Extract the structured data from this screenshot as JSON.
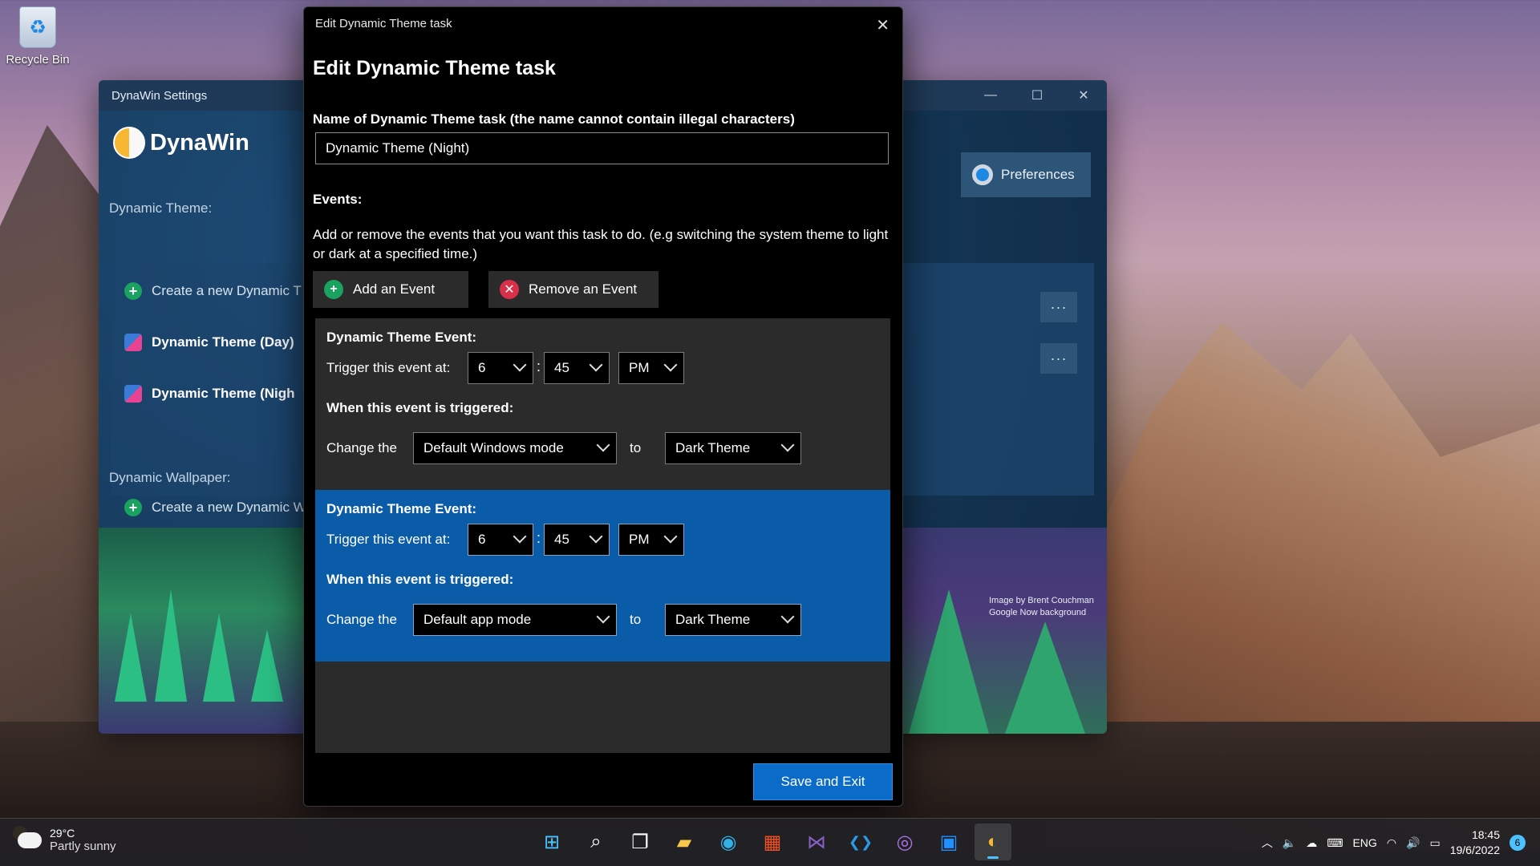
{
  "desktop": {
    "recycle_bin_label": "Recycle Bin"
  },
  "main_window": {
    "title": "DynaWin Settings",
    "app_name": "DynaWin",
    "controls": {
      "minimize": "—",
      "maximize": "☐",
      "close": "✕"
    },
    "dynamic_theme_label": "Dynamic Theme:",
    "dynamic_wallpaper_label": "Dynamic Wallpaper:",
    "preferences_label": "Preferences",
    "theme_items": [
      {
        "label": "Create a new Dynamic T",
        "type": "create"
      },
      {
        "label": "Dynamic Theme (Day)",
        "type": "theme"
      },
      {
        "label": "Dynamic Theme (Nigh",
        "type": "theme"
      }
    ],
    "wallpaper_items": [
      {
        "label": "Create a new Dynamic W",
        "type": "create"
      }
    ],
    "more_label": "···",
    "image_credit_line1": "Image by Brent Couchman",
    "image_credit_line2": "Google Now background"
  },
  "dialog": {
    "window_title": "Edit Dynamic Theme task",
    "close_icon": "✕",
    "heading": "Edit Dynamic Theme task",
    "name_label": "Name of Dynamic Theme task (the name cannot contain illegal characters)",
    "name_value": "Dynamic Theme (Night)",
    "events_label": "Events:",
    "events_description": "Add or remove the events that you want this task to do. (e.g switching the system theme to light or dark at a specified time.)",
    "add_event_label": "Add an Event",
    "remove_event_label": "Remove an Event",
    "events": [
      {
        "title": "Dynamic Theme Event:",
        "trigger_label": "Trigger this event at:",
        "hour": "6",
        "minute": "45",
        "ampm": "PM",
        "when_label": "When this event is triggered:",
        "change_label": "Change the",
        "mode": "Default Windows mode",
        "to_label": "to",
        "theme": "Dark Theme",
        "selected": false
      },
      {
        "title": "Dynamic Theme Event:",
        "trigger_label": "Trigger this event at:",
        "hour": "6",
        "minute": "45",
        "ampm": "PM",
        "when_label": "When this event is triggered:",
        "change_label": "Change the",
        "mode": "Default app mode",
        "to_label": "to",
        "theme": "Dark Theme",
        "selected": true
      }
    ],
    "save_label": "Save and Exit"
  },
  "taskbar": {
    "weather_temp": "29°C",
    "weather_desc": "Partly sunny",
    "apps": [
      {
        "name": "start-icon",
        "glyph": "⊞"
      },
      {
        "name": "search-icon",
        "glyph": "⌕"
      },
      {
        "name": "task-view-icon",
        "glyph": "❐"
      },
      {
        "name": "file-explorer-icon",
        "glyph": "▰"
      },
      {
        "name": "edge-icon",
        "glyph": "◉"
      },
      {
        "name": "store-icon",
        "glyph": "▦"
      },
      {
        "name": "visual-studio-icon",
        "glyph": "⋈"
      },
      {
        "name": "vscode-icon",
        "glyph": "❮❯"
      },
      {
        "name": "github-icon",
        "glyph": "◎"
      },
      {
        "name": "app-icon",
        "glyph": "▣"
      },
      {
        "name": "dynawin-icon",
        "glyph": "◐"
      }
    ],
    "language": "ENG",
    "time": "18:45",
    "date": "19/6/2022",
    "notification_count": "6"
  }
}
